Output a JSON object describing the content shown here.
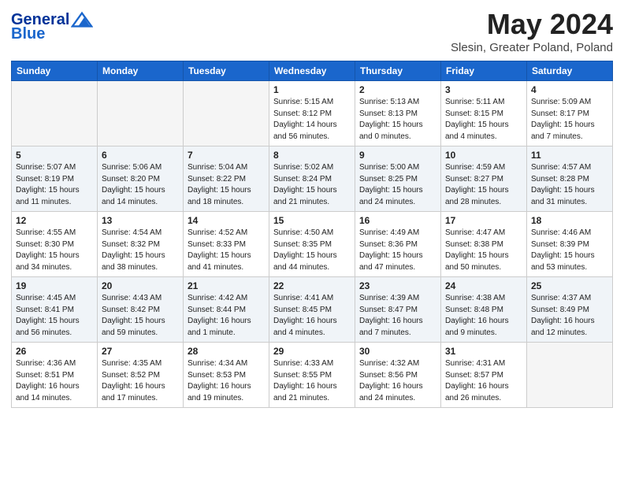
{
  "header": {
    "logo_line1": "General",
    "logo_line2": "Blue",
    "month": "May 2024",
    "location": "Slesin, Greater Poland, Poland"
  },
  "days_of_week": [
    "Sunday",
    "Monday",
    "Tuesday",
    "Wednesday",
    "Thursday",
    "Friday",
    "Saturday"
  ],
  "weeks": [
    [
      {
        "day": "",
        "info": ""
      },
      {
        "day": "",
        "info": ""
      },
      {
        "day": "",
        "info": ""
      },
      {
        "day": "1",
        "info": "Sunrise: 5:15 AM\nSunset: 8:12 PM\nDaylight: 14 hours\nand 56 minutes."
      },
      {
        "day": "2",
        "info": "Sunrise: 5:13 AM\nSunset: 8:13 PM\nDaylight: 15 hours\nand 0 minutes."
      },
      {
        "day": "3",
        "info": "Sunrise: 5:11 AM\nSunset: 8:15 PM\nDaylight: 15 hours\nand 4 minutes."
      },
      {
        "day": "4",
        "info": "Sunrise: 5:09 AM\nSunset: 8:17 PM\nDaylight: 15 hours\nand 7 minutes."
      }
    ],
    [
      {
        "day": "5",
        "info": "Sunrise: 5:07 AM\nSunset: 8:19 PM\nDaylight: 15 hours\nand 11 minutes."
      },
      {
        "day": "6",
        "info": "Sunrise: 5:06 AM\nSunset: 8:20 PM\nDaylight: 15 hours\nand 14 minutes."
      },
      {
        "day": "7",
        "info": "Sunrise: 5:04 AM\nSunset: 8:22 PM\nDaylight: 15 hours\nand 18 minutes."
      },
      {
        "day": "8",
        "info": "Sunrise: 5:02 AM\nSunset: 8:24 PM\nDaylight: 15 hours\nand 21 minutes."
      },
      {
        "day": "9",
        "info": "Sunrise: 5:00 AM\nSunset: 8:25 PM\nDaylight: 15 hours\nand 24 minutes."
      },
      {
        "day": "10",
        "info": "Sunrise: 4:59 AM\nSunset: 8:27 PM\nDaylight: 15 hours\nand 28 minutes."
      },
      {
        "day": "11",
        "info": "Sunrise: 4:57 AM\nSunset: 8:28 PM\nDaylight: 15 hours\nand 31 minutes."
      }
    ],
    [
      {
        "day": "12",
        "info": "Sunrise: 4:55 AM\nSunset: 8:30 PM\nDaylight: 15 hours\nand 34 minutes."
      },
      {
        "day": "13",
        "info": "Sunrise: 4:54 AM\nSunset: 8:32 PM\nDaylight: 15 hours\nand 38 minutes."
      },
      {
        "day": "14",
        "info": "Sunrise: 4:52 AM\nSunset: 8:33 PM\nDaylight: 15 hours\nand 41 minutes."
      },
      {
        "day": "15",
        "info": "Sunrise: 4:50 AM\nSunset: 8:35 PM\nDaylight: 15 hours\nand 44 minutes."
      },
      {
        "day": "16",
        "info": "Sunrise: 4:49 AM\nSunset: 8:36 PM\nDaylight: 15 hours\nand 47 minutes."
      },
      {
        "day": "17",
        "info": "Sunrise: 4:47 AM\nSunset: 8:38 PM\nDaylight: 15 hours\nand 50 minutes."
      },
      {
        "day": "18",
        "info": "Sunrise: 4:46 AM\nSunset: 8:39 PM\nDaylight: 15 hours\nand 53 minutes."
      }
    ],
    [
      {
        "day": "19",
        "info": "Sunrise: 4:45 AM\nSunset: 8:41 PM\nDaylight: 15 hours\nand 56 minutes."
      },
      {
        "day": "20",
        "info": "Sunrise: 4:43 AM\nSunset: 8:42 PM\nDaylight: 15 hours\nand 59 minutes."
      },
      {
        "day": "21",
        "info": "Sunrise: 4:42 AM\nSunset: 8:44 PM\nDaylight: 16 hours\nand 1 minute."
      },
      {
        "day": "22",
        "info": "Sunrise: 4:41 AM\nSunset: 8:45 PM\nDaylight: 16 hours\nand 4 minutes."
      },
      {
        "day": "23",
        "info": "Sunrise: 4:39 AM\nSunset: 8:47 PM\nDaylight: 16 hours\nand 7 minutes."
      },
      {
        "day": "24",
        "info": "Sunrise: 4:38 AM\nSunset: 8:48 PM\nDaylight: 16 hours\nand 9 minutes."
      },
      {
        "day": "25",
        "info": "Sunrise: 4:37 AM\nSunset: 8:49 PM\nDaylight: 16 hours\nand 12 minutes."
      }
    ],
    [
      {
        "day": "26",
        "info": "Sunrise: 4:36 AM\nSunset: 8:51 PM\nDaylight: 16 hours\nand 14 minutes."
      },
      {
        "day": "27",
        "info": "Sunrise: 4:35 AM\nSunset: 8:52 PM\nDaylight: 16 hours\nand 17 minutes."
      },
      {
        "day": "28",
        "info": "Sunrise: 4:34 AM\nSunset: 8:53 PM\nDaylight: 16 hours\nand 19 minutes."
      },
      {
        "day": "29",
        "info": "Sunrise: 4:33 AM\nSunset: 8:55 PM\nDaylight: 16 hours\nand 21 minutes."
      },
      {
        "day": "30",
        "info": "Sunrise: 4:32 AM\nSunset: 8:56 PM\nDaylight: 16 hours\nand 24 minutes."
      },
      {
        "day": "31",
        "info": "Sunrise: 4:31 AM\nSunset: 8:57 PM\nDaylight: 16 hours\nand 26 minutes."
      },
      {
        "day": "",
        "info": ""
      }
    ]
  ]
}
